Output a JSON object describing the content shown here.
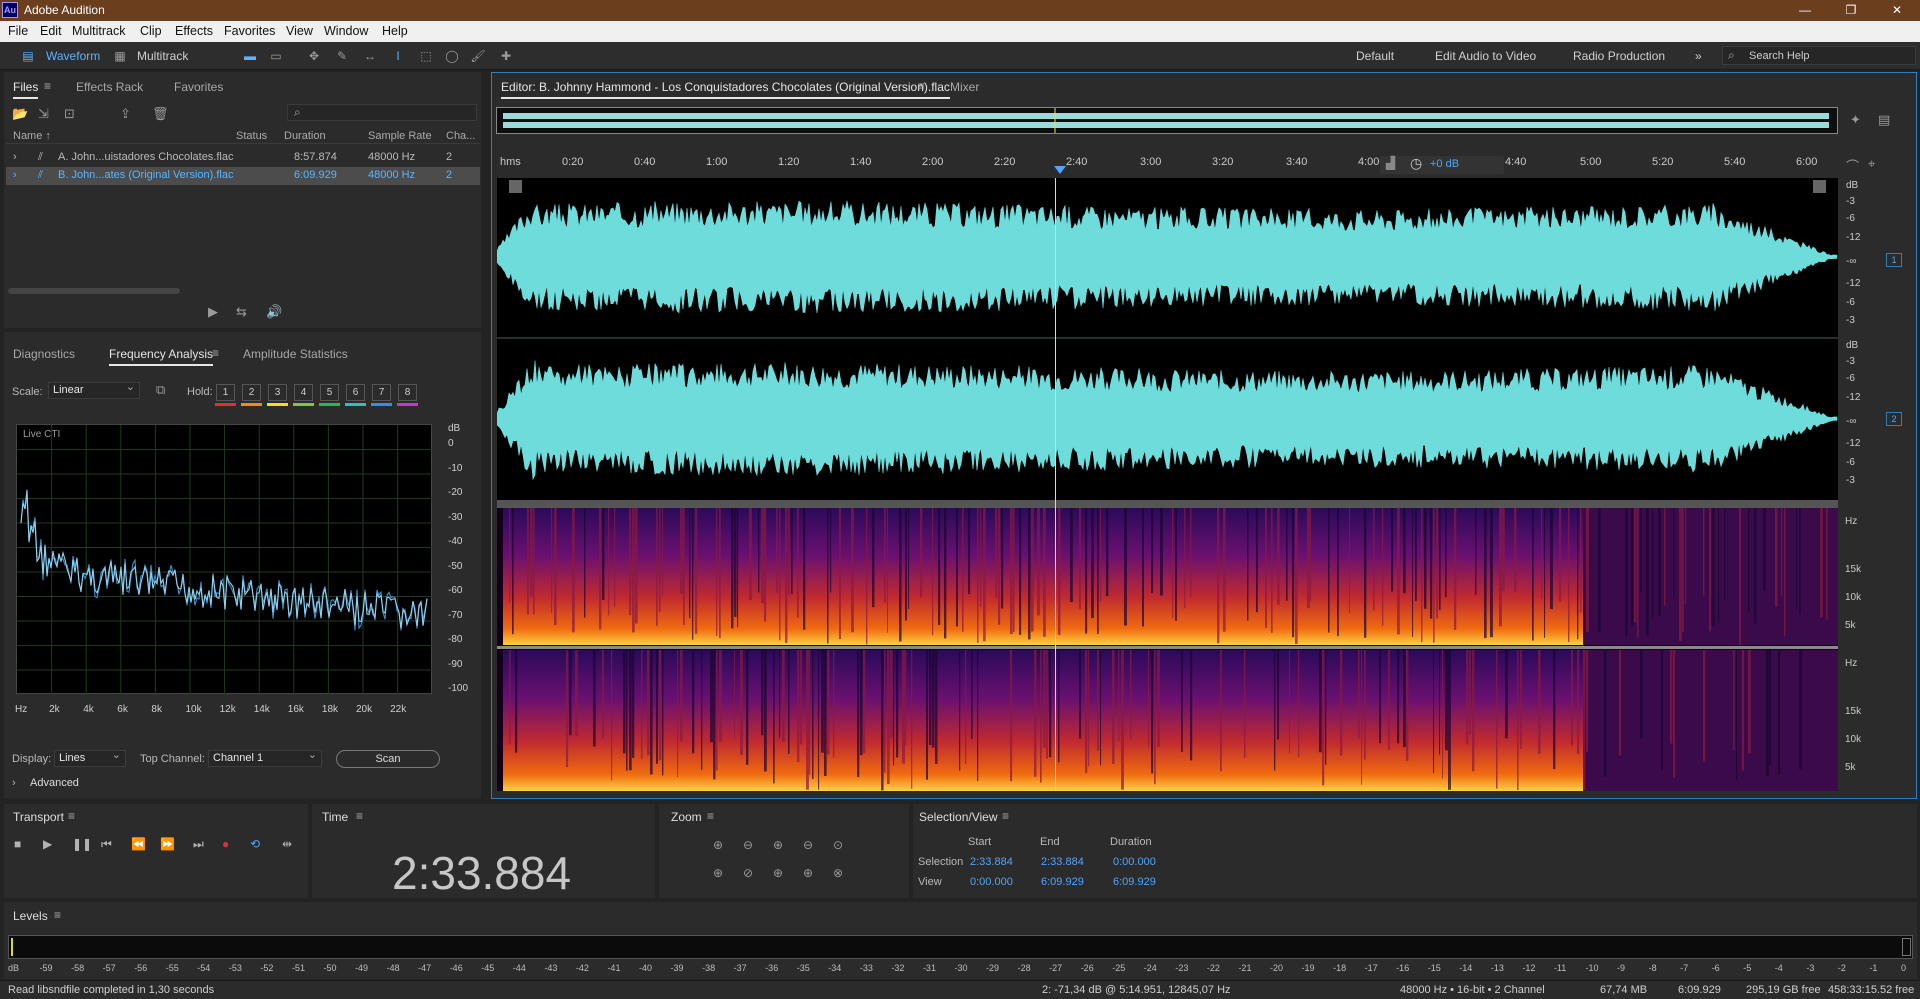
{
  "app": {
    "title": "Adobe Audition",
    "logo": "Au"
  },
  "menu": [
    "File",
    "Edit",
    "Multitrack",
    "Clip",
    "Effects",
    "Favorites",
    "View",
    "Window",
    "Help"
  ],
  "toolbar": {
    "waveform": "Waveform",
    "multitrack": "Multitrack",
    "workspaces": [
      "Default",
      "Edit Audio to Video",
      "Radio Production"
    ],
    "search_placeholder": "Search Help"
  },
  "files_panel": {
    "tabs": [
      "Files",
      "Effects Rack",
      "Favorites"
    ],
    "search_placeholder": "⌕",
    "columns": [
      "Name ↑",
      "Status",
      "Duration",
      "Sample Rate",
      "Cha..."
    ],
    "rows": [
      {
        "name": "A. John...uistadores Chocolates.flac",
        "duration": "8:57.874",
        "rate": "48000 Hz",
        "ch": "2"
      },
      {
        "name": "B. John...ates (Original Version).flac",
        "duration": "6:09.929",
        "rate": "48000 Hz",
        "ch": "2"
      }
    ]
  },
  "analysis": {
    "tabs": [
      "Diagnostics",
      "Frequency Analysis",
      "Amplitude Statistics"
    ],
    "scale_label": "Scale:",
    "scale_value": "Linear",
    "hold_label": "Hold:",
    "holds": [
      "1",
      "2",
      "3",
      "4",
      "5",
      "6",
      "7",
      "8"
    ],
    "hold_colors": [
      "#e03030",
      "#f08a1c",
      "#e8e020",
      "#6ed13a",
      "#2fb84a",
      "#29c2c2",
      "#2f8fe8",
      "#d030d0"
    ],
    "graph_label": "Live CTI",
    "db_unit": "dB",
    "db_ticks": [
      "0",
      "-10",
      "-20",
      "-30",
      "-40",
      "-50",
      "-60",
      "-70",
      "-80",
      "-90",
      "-100"
    ],
    "hz_ticks": [
      "Hz",
      "2k",
      "4k",
      "6k",
      "8k",
      "10k",
      "12k",
      "14k",
      "16k",
      "18k",
      "20k",
      "22k"
    ],
    "display_label": "Display:",
    "display_value": "Lines",
    "top_channel_label": "Top Channel:",
    "top_channel_value": "Channel 1",
    "scan": "Scan",
    "advanced": "Advanced"
  },
  "editor": {
    "tab_title": "Editor: B. Johnny Hammond - Los Conquistadores Chocolates (Original Version).flac",
    "mixer": "Mixer",
    "ruler": [
      "hms",
      "0:20",
      "0:40",
      "1:00",
      "1:20",
      "1:40",
      "2:00",
      "2:20",
      "2:40",
      "3:00",
      "3:20",
      "3:40",
      "4:00",
      "4:40",
      "5:00",
      "5:20",
      "5:40",
      "6:00"
    ],
    "hud": "+0 dB",
    "db_scale": [
      "dB",
      "-3",
      "-6",
      "-12",
      "-∞",
      "-12",
      "-6",
      "-3"
    ],
    "channels": [
      "1",
      "2"
    ],
    "hz_scale": [
      "Hz",
      "15k",
      "10k",
      "5k"
    ]
  },
  "transport": {
    "title": "Transport"
  },
  "time": {
    "title": "Time",
    "value": "2:33.884"
  },
  "zoom": {
    "title": "Zoom"
  },
  "selection": {
    "title": "Selection/View",
    "cols": [
      "Start",
      "End",
      "Duration"
    ],
    "rows": [
      {
        "label": "Selection",
        "start": "2:33.884",
        "end": "2:33.884",
        "duration": "0:00.000"
      },
      {
        "label": "View",
        "start": "0:00.000",
        "end": "6:09.929",
        "duration": "6:09.929"
      }
    ]
  },
  "levels": {
    "title": "Levels",
    "ticks": [
      "dB",
      "-59",
      "-58",
      "-57",
      "-56",
      "-55",
      "-54",
      "-53",
      "-52",
      "-51",
      "-50",
      "-49",
      "-48",
      "-47",
      "-46",
      "-45",
      "-44",
      "-43",
      "-42",
      "-41",
      "-40",
      "-39",
      "-38",
      "-37",
      "-36",
      "-35",
      "-34",
      "-33",
      "-32",
      "-31",
      "-30",
      "-29",
      "-28",
      "-27",
      "-26",
      "-25",
      "-24",
      "-23",
      "-22",
      "-21",
      "-20",
      "-19",
      "-18",
      "-17",
      "-16",
      "-15",
      "-14",
      "-13",
      "-12",
      "-11",
      "-10",
      "-9",
      "-8",
      "-7",
      "-6",
      "-5",
      "-4",
      "-3",
      "-2",
      "-1",
      "0"
    ]
  },
  "status": {
    "message": "Read libsndfile completed in 1,30 seconds",
    "cursor": "2: -71,34 dB @ 5:14.951, 12845,07 Hz",
    "format": "48000 Hz • 16-bit • 2 Channel",
    "size": "67,74 MB",
    "duration": "6:09.929",
    "free": "295,19 GB free",
    "free_time": "458:33:15.52 free"
  }
}
